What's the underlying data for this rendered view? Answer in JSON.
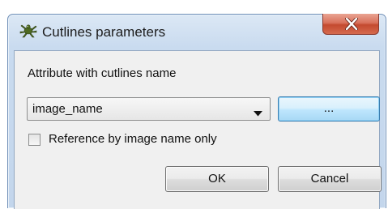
{
  "window": {
    "title": "Cutlines parameters",
    "icon": "plugin-icon",
    "close_icon": "close-icon",
    "accent_color": "#c44a30"
  },
  "form": {
    "attribute_label": "Attribute with cutlines name",
    "attribute_select": {
      "selected": "image_name"
    },
    "browse_button": "...",
    "reference_checkbox": {
      "label": "Reference by image name only",
      "checked": false
    }
  },
  "buttons": {
    "ok": "OK",
    "cancel": "Cancel"
  }
}
